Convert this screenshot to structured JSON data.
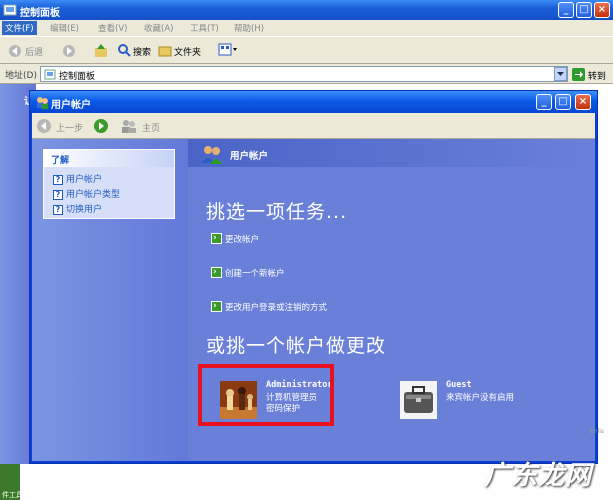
{
  "back_window": {
    "title": "控制面板",
    "menu": [
      "文件(F)",
      "编辑(E)",
      "查看(V)",
      "收藏(A)",
      "工具(T)",
      "帮助(H)"
    ],
    "toolbar": {
      "back": "后退",
      "search": "搜索",
      "folders": "文件夹"
    },
    "address": {
      "label": "地址(D)",
      "value": "控制面板",
      "go": "转到"
    },
    "side_stub": "让"
  },
  "front_window": {
    "title": "用户帐户",
    "nav": {
      "back": "上一步",
      "home": "主页"
    },
    "sidebar": {
      "heading": "了解",
      "items": [
        "用户帐户",
        "用户帐户类型",
        "切换用户"
      ]
    },
    "main": {
      "header": "用户帐户",
      "pick_task": "挑选一项任务...",
      "tasks": [
        "更改帐户",
        "创建一个新帐户",
        "更改用户登录或注销的方式"
      ],
      "or_pick_account": "或挑一个帐户做更改",
      "accounts": [
        {
          "name": "Administrator",
          "lines": [
            "计算机管理员",
            "密码保护"
          ]
        },
        {
          "name": "Guest",
          "lines": [
            "来宾帐户没有启用"
          ]
        }
      ]
    }
  },
  "watermark": "广东龙网",
  "watermark_small": "Enlis",
  "desktop_label": "件工具",
  "colors": {
    "title_blue": "#0a5ae8",
    "panel_blue": "#6a80d8",
    "highlight_red": "#e8101e"
  }
}
